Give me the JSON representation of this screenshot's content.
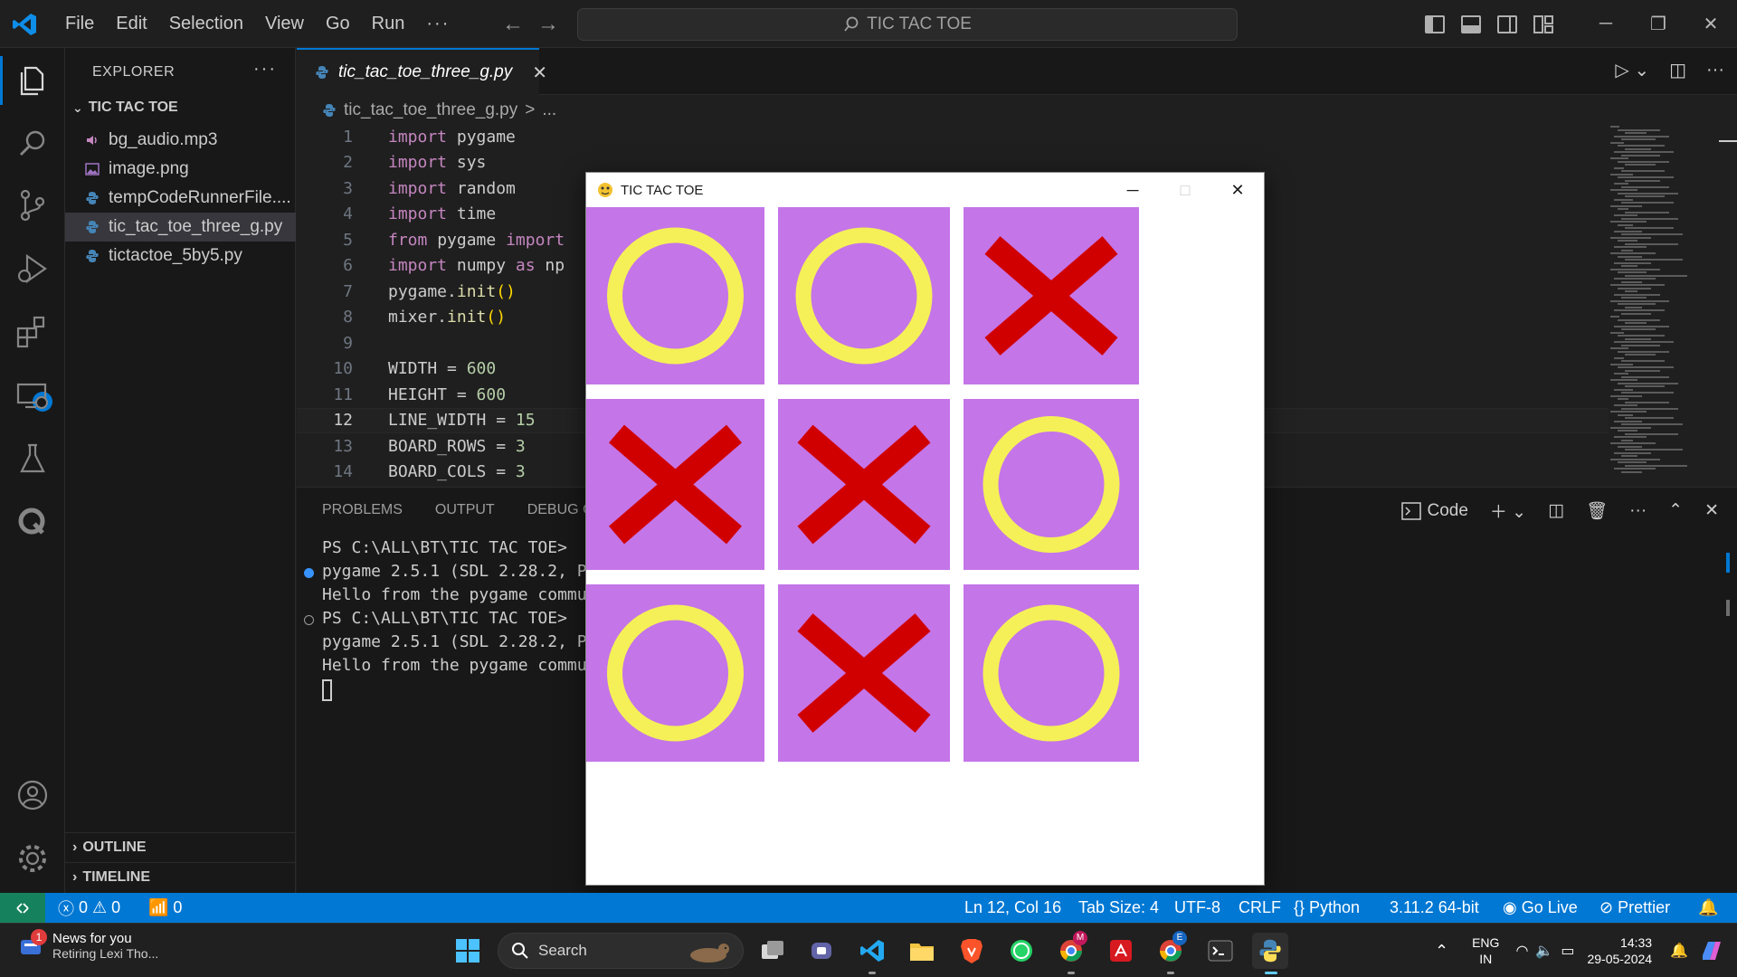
{
  "titlebar": {
    "menu": [
      "File",
      "Edit",
      "Selection",
      "View",
      "Go",
      "Run"
    ],
    "more": "···",
    "search_text": "TIC TAC TOE",
    "window_min": "─",
    "window_restore": "❐",
    "window_close": "✕"
  },
  "activity": {
    "extensions_badge": "1"
  },
  "sidebar": {
    "title": "EXPLORER",
    "more": "···",
    "folder": "TIC TAC TOE",
    "files": [
      {
        "name": "bg_audio.mp3",
        "icon": "audio-file-icon"
      },
      {
        "name": "image.png",
        "icon": "image-file-icon"
      },
      {
        "name": "tempCodeRunnerFile....",
        "icon": "python-file-icon"
      },
      {
        "name": "tic_tac_toe_three_g.py",
        "icon": "python-file-icon"
      },
      {
        "name": "tictactoe_5by5.py",
        "icon": "python-file-icon"
      }
    ],
    "outline": "OUTLINE",
    "timeline": "TIMELINE"
  },
  "editor": {
    "tab_label": "tic_tac_toe_three_g.py",
    "tab_close": "✕",
    "breadcrumb_file": "tic_tac_toe_three_g.py",
    "breadcrumb_sep": ">",
    "breadcrumb_more": "...",
    "line_numbers": [
      "1",
      "2",
      "3",
      "4",
      "5",
      "6",
      "7",
      "8",
      "9",
      "10",
      "11",
      "12",
      "13",
      "14"
    ],
    "current_line": 12,
    "code": {
      "l1_kw": "import",
      "l1_rest": " pygame",
      "l2_kw": "import",
      "l2_rest": " sys",
      "l3_kw": "import",
      "l3_rest": " random",
      "l4_kw": "import",
      "l4_rest": " time",
      "l5_kw": "from",
      "l5_mid": " pygame ",
      "l5_kw2": "import",
      "l6_kw": "import",
      "l6_mid": " numpy ",
      "l6_kw2": "as",
      "l6_rest": " np",
      "l7_pre": "pygame.",
      "l7_fn": "init",
      "l7_paren": "()",
      "l8_pre": "mixer.",
      "l8_fn": "init",
      "l8_paren": "()",
      "l10_pre": "WIDTH = ",
      "l10_num": "600",
      "l11_pre": "HEIGHT = ",
      "l11_num": "600",
      "l12_pre": "LINE_WIDTH = ",
      "l12_num": "15",
      "l13_pre": "BOARD_ROWS = ",
      "l13_num": "3",
      "l14_pre": "BOARD_COLS = ",
      "l14_num": "3"
    }
  },
  "panel": {
    "tabs": [
      "PROBLEMS",
      "OUTPUT",
      "DEBUG CO"
    ],
    "terminal_name": "Code",
    "terminal_lines": [
      "PS C:\\ALL\\BT\\TIC TAC TOE> ",
      "pygame 2.5.1 (SDL 2.28.2, P",
      "Hello from the pygame commu",
      "PS C:\\ALL\\BT\\TIC TAC TOE> ",
      "pygame 2.5.1 (SDL 2.28.2, P",
      "Hello from the pygame commu"
    ]
  },
  "game": {
    "title": "TIC TAC TOE",
    "board": [
      "O",
      "O",
      "X",
      "X",
      "X",
      "O",
      "O",
      "X",
      "O"
    ],
    "colors": {
      "cell": "#c475e8",
      "grid": "#ffffff",
      "circle": "#f5f057",
      "cross": "#d10000"
    }
  },
  "statusbar": {
    "errors": "0",
    "warnings": "0",
    "ports": "0",
    "position": "Ln 12, Col 16",
    "tab_size": "Tab Size: 4",
    "encoding": "UTF-8",
    "eol": "CRLF",
    "language": "Python",
    "interpreter": "3.11.2 64-bit",
    "go_live": "Go Live",
    "prettier": "Prettier"
  },
  "taskbar": {
    "news_badge": "1",
    "news_title": "News for you",
    "news_sub": "Retiring Lexi Tho...",
    "search_label": "Search",
    "lang_top": "ENG",
    "lang_bottom": "IN",
    "time": "14:33",
    "date": "29-05-2024",
    "chrome_badge_1": "M",
    "chrome_badge_2": "E"
  }
}
